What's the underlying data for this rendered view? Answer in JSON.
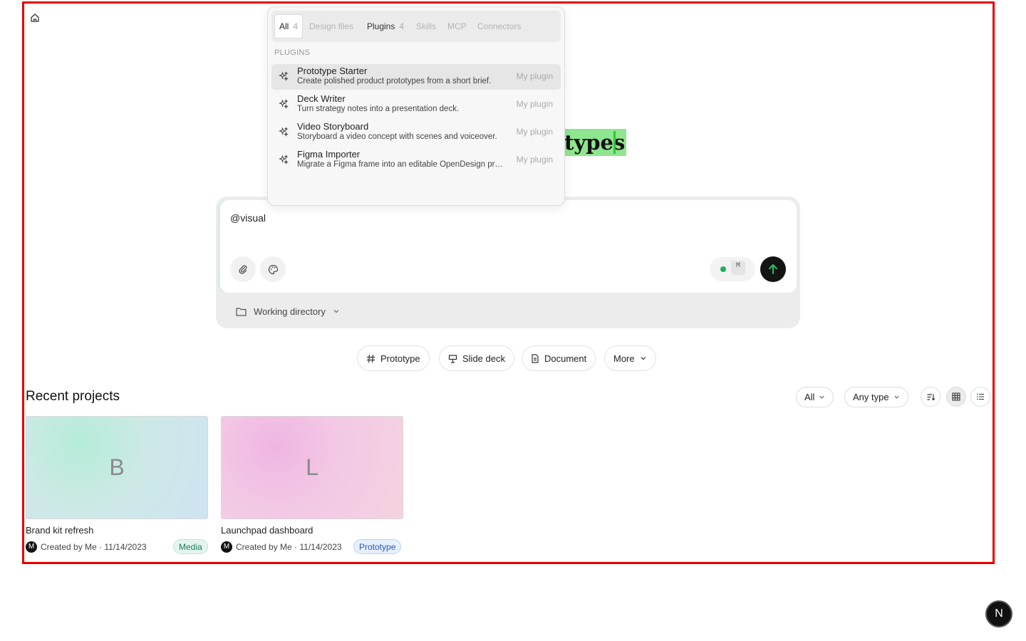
{
  "hero": {
    "visible_text": "types"
  },
  "composer": {
    "input_value": "@visual",
    "model_badge": "M",
    "working_directory": "Working directory"
  },
  "popup": {
    "tabs": [
      {
        "label": "All",
        "count": "4"
      },
      {
        "label": "Design files",
        "count": ""
      },
      {
        "label": "Plugins",
        "count": "4"
      },
      {
        "label": "Skills",
        "count": ""
      },
      {
        "label": "MCP",
        "count": ""
      },
      {
        "label": "Connectors",
        "count": ""
      }
    ],
    "section_label": "PLUGINS",
    "items": [
      {
        "title": "Prototype Starter",
        "description": "Create polished product prototypes from a short brief.",
        "tag": "My plugin"
      },
      {
        "title": "Deck Writer",
        "description": "Turn strategy notes into a presentation deck.",
        "tag": "My plugin"
      },
      {
        "title": "Video Storyboard",
        "description": "Storyboard a video concept with scenes and voiceover.",
        "tag": "My plugin"
      },
      {
        "title": "Figma Importer",
        "description": "Migrate a Figma frame into an editable OpenDesign project.",
        "tag": "My plugin"
      }
    ]
  },
  "quick_actions": [
    {
      "label": "Prototype",
      "icon": "hash-icon"
    },
    {
      "label": "Slide deck",
      "icon": "easel-icon"
    },
    {
      "label": "Document",
      "icon": "document-icon"
    },
    {
      "label": "More",
      "icon": "chevron-down-icon"
    }
  ],
  "recent": {
    "title": "Recent projects",
    "filter_scope": "All",
    "filter_type": "Any type",
    "cards": [
      {
        "initial": "B",
        "name": "Brand kit refresh",
        "avatar": "M",
        "meta": "Created by Me · 11/14/2023",
        "tag": "Media",
        "tag_color": "#1d7a58"
      },
      {
        "initial": "L",
        "name": "Launchpad dashboard",
        "avatar": "M",
        "meta": "Created by Me · 11/14/2023",
        "tag": "Prototype",
        "tag_color": "#2a5bb5"
      }
    ]
  },
  "next_badge": "N",
  "colors": {
    "accent_send": "#141414",
    "send_arrow": "#22c55e",
    "frame_border": "#e60000",
    "highlight": "#8ee68e"
  }
}
